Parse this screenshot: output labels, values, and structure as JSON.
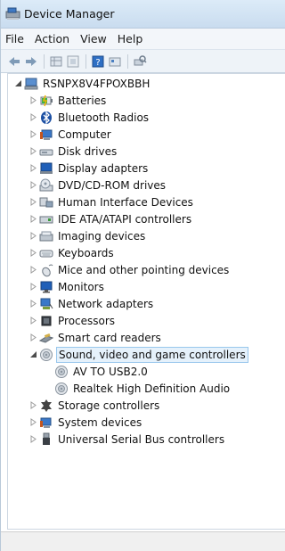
{
  "window": {
    "title": "Device Manager",
    "icon": "device-manager-icon"
  },
  "menu": [
    {
      "label": "File"
    },
    {
      "label": "Action"
    },
    {
      "label": "View"
    },
    {
      "label": "Help"
    }
  ],
  "toolbar": [
    {
      "icon": "back-arrow-icon"
    },
    {
      "icon": "forward-arrow-icon"
    },
    {
      "icon": "properties-grid-icon"
    },
    {
      "icon": "show-hidden-icon"
    },
    {
      "icon": "help-book-icon"
    },
    {
      "icon": "update-driver-icon"
    },
    {
      "icon": "scan-hardware-icon"
    }
  ],
  "tree": {
    "root": {
      "label": "RSNPX8V4FPOXBBH",
      "expanded": true,
      "icon": "computer-icon"
    },
    "categories": [
      {
        "label": "Batteries",
        "icon": "battery-icon",
        "expanded": false
      },
      {
        "label": "Bluetooth Radios",
        "icon": "bluetooth-icon",
        "expanded": false
      },
      {
        "label": "Computer",
        "icon": "computer-category-icon",
        "expanded": false
      },
      {
        "label": "Disk drives",
        "icon": "disk-drive-icon",
        "expanded": false
      },
      {
        "label": "Display adapters",
        "icon": "display-adapter-icon",
        "expanded": false
      },
      {
        "label": "DVD/CD-ROM drives",
        "icon": "dvd-drive-icon",
        "expanded": false
      },
      {
        "label": "Human Interface Devices",
        "icon": "hid-icon",
        "expanded": false
      },
      {
        "label": "IDE ATA/ATAPI controllers",
        "icon": "ide-controller-icon",
        "expanded": false
      },
      {
        "label": "Imaging devices",
        "icon": "imaging-device-icon",
        "expanded": false
      },
      {
        "label": "Keyboards",
        "icon": "keyboard-icon",
        "expanded": false
      },
      {
        "label": "Mice and other pointing devices",
        "icon": "mouse-icon",
        "expanded": false
      },
      {
        "label": "Monitors",
        "icon": "monitor-icon",
        "expanded": false
      },
      {
        "label": "Network adapters",
        "icon": "network-adapter-icon",
        "expanded": false
      },
      {
        "label": "Processors",
        "icon": "processor-icon",
        "expanded": false
      },
      {
        "label": "Smart card readers",
        "icon": "smart-card-reader-icon",
        "expanded": false
      },
      {
        "label": "Sound, video and game controllers",
        "icon": "speaker-icon",
        "expanded": true,
        "selected": true,
        "children": [
          {
            "label": "AV TO USB2.0",
            "icon": "speaker-icon"
          },
          {
            "label": "Realtek High Definition Audio",
            "icon": "speaker-icon"
          }
        ]
      },
      {
        "label": "Storage controllers",
        "icon": "storage-controller-icon",
        "expanded": false
      },
      {
        "label": "System devices",
        "icon": "system-devices-icon",
        "expanded": false
      },
      {
        "label": "Universal Serial Bus controllers",
        "icon": "usb-icon",
        "expanded": false
      }
    ]
  }
}
